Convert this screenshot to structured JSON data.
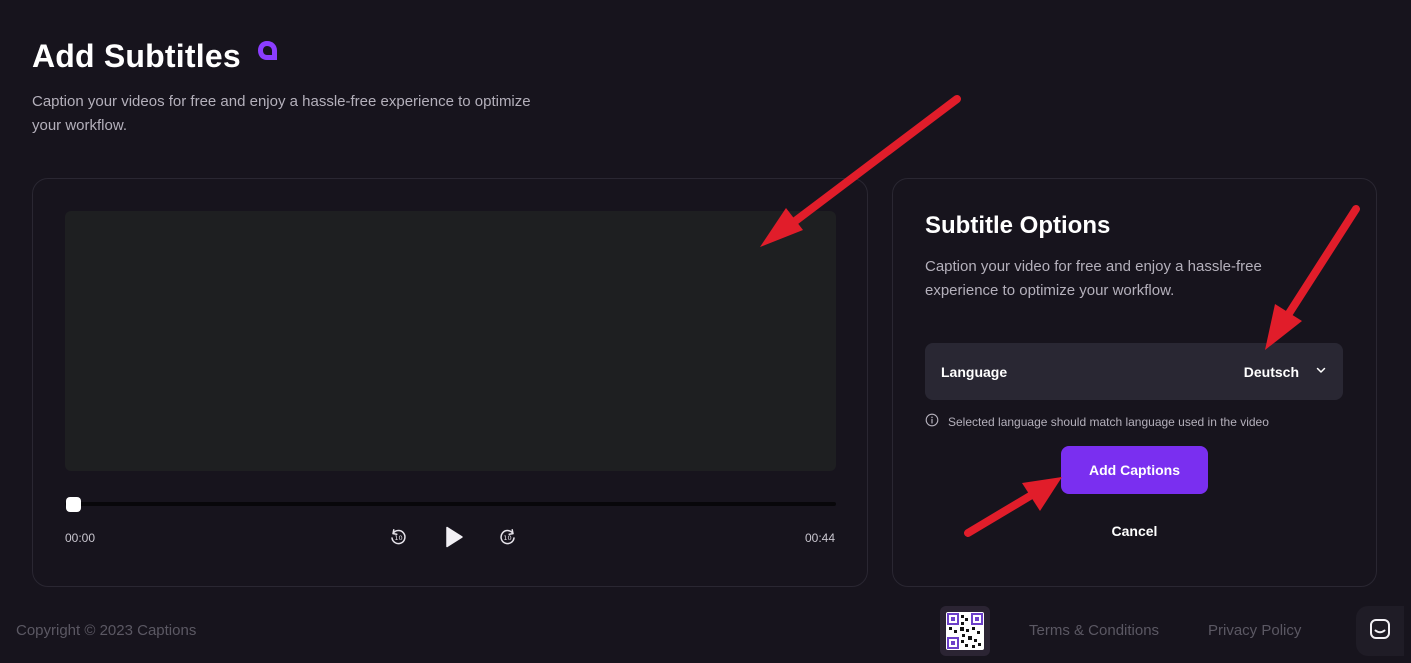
{
  "header": {
    "title": "Add Subtitles",
    "subtitle": "Caption your videos for free and enjoy a hassle-free experience to optimize your workflow.",
    "logo_icon": "captions-logo-icon"
  },
  "player": {
    "current_time": "00:00",
    "duration": "00:44",
    "progress": 0,
    "controls": {
      "rewind_icon": "rewind-10-icon",
      "play_icon": "play-icon",
      "forward_icon": "forward-10-icon",
      "skip_label": "10"
    }
  },
  "options": {
    "title": "Subtitle Options",
    "description": "Caption your video for free and enjoy a hassle-free experience to optimize your workflow.",
    "language_label": "Language",
    "language_value": "Deutsch",
    "hint": "Selected language should match language used in the video",
    "add_button": "Add Captions",
    "cancel_button": "Cancel"
  },
  "footer": {
    "copyright": "Copyright © 2023 Captions",
    "terms": "Terms & Conditions",
    "privacy": "Privacy Policy"
  },
  "colors": {
    "background": "#17141d",
    "accent": "#7a2ff0",
    "annotation_arrow": "#e11d2a",
    "card_border": "#2a2732"
  }
}
